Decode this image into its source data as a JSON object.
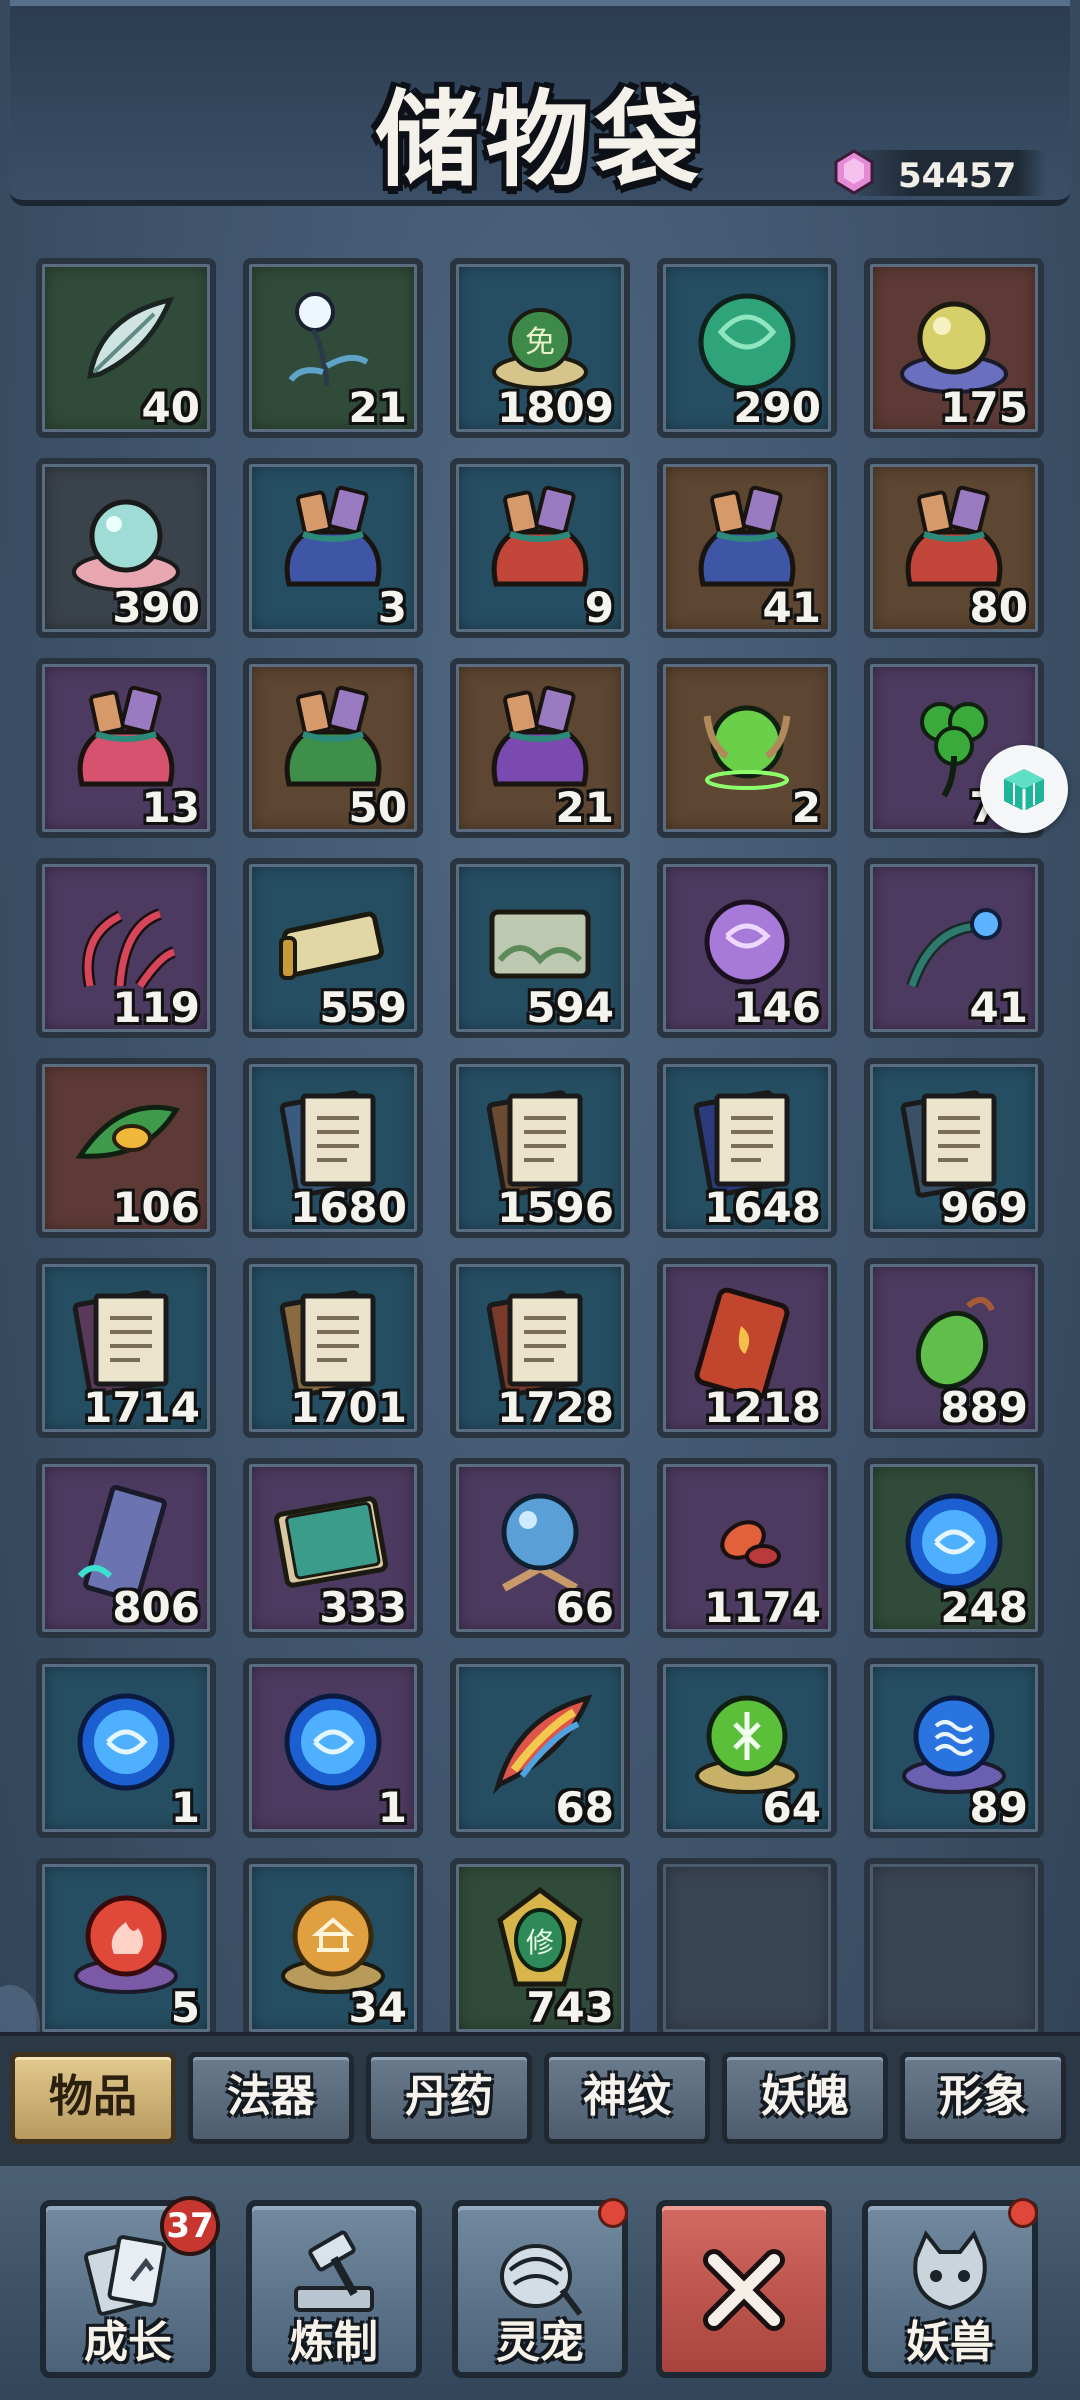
{
  "header": {
    "title": "储物袋",
    "currency": {
      "icon": "pink-gem-icon",
      "value": "54457"
    }
  },
  "inventory": [
    {
      "name": "feather-icon",
      "quality": "green",
      "count": "40"
    },
    {
      "name": "spirit-flower-icon",
      "quality": "green",
      "count": "21"
    },
    {
      "name": "exemption-token-icon",
      "quality": "blue",
      "count": "1809"
    },
    {
      "name": "jade-orb-icon",
      "quality": "blue",
      "count": "290"
    },
    {
      "name": "golden-pearl-icon",
      "quality": "red",
      "count": "175"
    },
    {
      "name": "shell-pearl-icon",
      "quality": "gray",
      "count": "390"
    },
    {
      "name": "blue-loot-bag-icon",
      "quality": "blue",
      "count": "3"
    },
    {
      "name": "red-loot-bag-icon",
      "quality": "blue",
      "count": "9"
    },
    {
      "name": "blue-loot-bag-icon",
      "quality": "orange",
      "count": "41"
    },
    {
      "name": "red-loot-bag-icon",
      "quality": "orange",
      "count": "80"
    },
    {
      "name": "pink-loot-bag-icon",
      "quality": "purple",
      "count": "13"
    },
    {
      "name": "green-loot-bag-icon",
      "quality": "orange",
      "count": "50"
    },
    {
      "name": "purple-loot-bag-icon",
      "quality": "orange",
      "count": "21"
    },
    {
      "name": "horned-orb-icon",
      "quality": "orange",
      "count": "2"
    },
    {
      "name": "clover-icon",
      "quality": "purple",
      "count": "79"
    },
    {
      "name": "red-herb-icon",
      "quality": "purple",
      "count": "119"
    },
    {
      "name": "golden-scroll-icon",
      "quality": "blue",
      "count": "559"
    },
    {
      "name": "map-scroll-icon",
      "quality": "blue",
      "count": "594"
    },
    {
      "name": "purple-orb-icon",
      "quality": "purple",
      "count": "146"
    },
    {
      "name": "blue-flower-icon",
      "quality": "purple",
      "count": "41"
    },
    {
      "name": "leaf-seed-icon",
      "quality": "red",
      "count": "106"
    },
    {
      "name": "blue-manual-icon",
      "quality": "blue",
      "count": "1680"
    },
    {
      "name": "brown-manual-icon",
      "quality": "blue",
      "count": "1596"
    },
    {
      "name": "navy-manual-icon",
      "quality": "blue",
      "count": "1648"
    },
    {
      "name": "slate-manual-icon",
      "quality": "blue",
      "count": "969"
    },
    {
      "name": "purple-manual-icon",
      "quality": "blue",
      "count": "1714"
    },
    {
      "name": "tan-manual-icon",
      "quality": "blue",
      "count": "1701"
    },
    {
      "name": "rust-manual-icon",
      "quality": "blue",
      "count": "1728"
    },
    {
      "name": "fire-scroll-icon",
      "quality": "purple",
      "count": "1218"
    },
    {
      "name": "green-pendant-icon",
      "quality": "purple",
      "count": "889"
    },
    {
      "name": "ghost-banner-icon",
      "quality": "purple",
      "count": "806"
    },
    {
      "name": "jade-book-icon",
      "quality": "purple",
      "count": "333"
    },
    {
      "name": "crystal-ball-icon",
      "quality": "purple",
      "count": "66"
    },
    {
      "name": "red-petal-icon",
      "quality": "purple",
      "count": "1174"
    },
    {
      "name": "blue-vortex-orb-icon",
      "quality": "green",
      "count": "248"
    },
    {
      "name": "blue-vortex-orb-icon",
      "quality": "blue",
      "count": "1"
    },
    {
      "name": "blue-vortex-orb-icon",
      "quality": "purple",
      "count": "1"
    },
    {
      "name": "rainbow-feather-icon",
      "quality": "blue",
      "count": "68"
    },
    {
      "name": "wood-rune-orb-icon",
      "quality": "blue",
      "count": "64"
    },
    {
      "name": "water-rune-orb-icon",
      "quality": "blue",
      "count": "89"
    },
    {
      "name": "fire-rune-orb-icon",
      "quality": "blue",
      "count": "5"
    },
    {
      "name": "earth-rune-orb-icon",
      "quality": "blue",
      "count": "34"
    },
    {
      "name": "gold-amulet-icon",
      "quality": "green",
      "count": "743"
    },
    {
      "name": "empty-slot",
      "quality": "empty",
      "count": ""
    },
    {
      "name": "empty-slot",
      "quality": "empty",
      "count": ""
    }
  ],
  "tabs": [
    {
      "label": "物品",
      "active": true
    },
    {
      "label": "法器",
      "active": false
    },
    {
      "label": "丹药",
      "active": false
    },
    {
      "label": "神纹",
      "active": false
    },
    {
      "label": "妖魄",
      "active": false
    },
    {
      "label": "形象",
      "active": false
    }
  ],
  "bottom_nav": [
    {
      "label": "成长",
      "icon": "growth-cards-icon",
      "badge": "37"
    },
    {
      "label": "炼制",
      "icon": "forge-hammer-icon",
      "badge_dot": true
    },
    {
      "label": "灵宠",
      "icon": "spirit-pet-icon",
      "badge_dot": true
    },
    {
      "label": "",
      "icon": "close-icon"
    },
    {
      "label": "妖兽",
      "icon": "demon-beast-icon",
      "badge_dot": true
    }
  ],
  "colors": {
    "background": "#3d5166",
    "tab_active": "#d8bd80",
    "close_button": "#c0564e",
    "badge": "#c8372f"
  }
}
